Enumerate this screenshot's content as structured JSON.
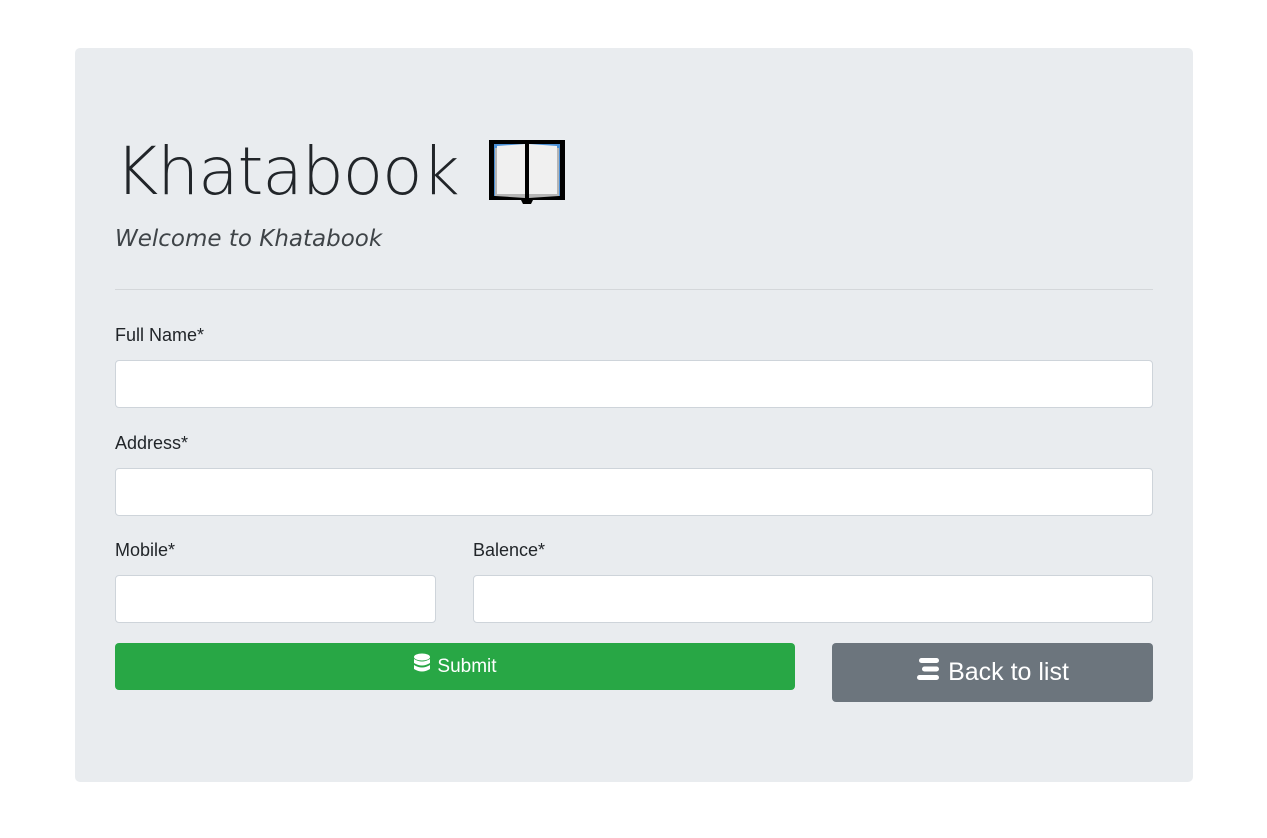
{
  "header": {
    "title": "Khatabook",
    "icon": "open-book-icon",
    "subtitle": "Welcome to Khatabook"
  },
  "form": {
    "full_name": {
      "label": "Full Name*",
      "value": "",
      "placeholder": ""
    },
    "address": {
      "label": "Address*",
      "value": "",
      "placeholder": ""
    },
    "mobile": {
      "label": "Mobile*",
      "value": "",
      "placeholder": ""
    },
    "balance": {
      "label": "Balence*",
      "value": "",
      "placeholder": ""
    }
  },
  "actions": {
    "submit": {
      "label": "Submit",
      "icon": "database-icon",
      "color": "#28a745"
    },
    "back": {
      "label": "Back to list",
      "icon": "list-icon",
      "color": "#6c757d"
    }
  },
  "colors": {
    "panel": "#e9ecef",
    "background": "#ffffff"
  }
}
